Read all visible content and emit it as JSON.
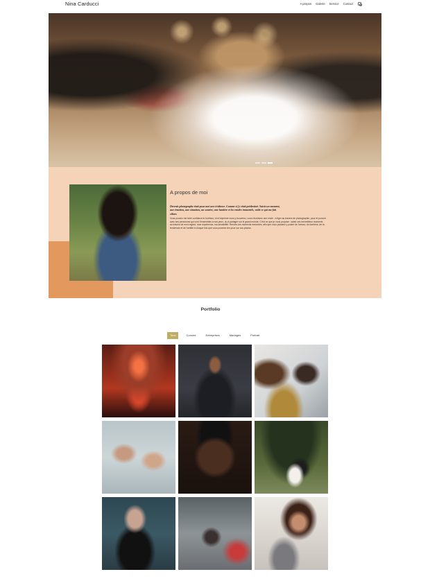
{
  "header": {
    "brand": "Nina Carducci",
    "nav": [
      "A propos",
      "Galerie",
      "Service",
      "Contact"
    ],
    "social_icon": "instagram-icon"
  },
  "hero": {
    "slides_count": 3,
    "active_slide": 3
  },
  "about": {
    "title": "A propos de moi",
    "lead": "Derenir photographe était pour moi une évidence. Comme si j'y était prédestiné. Saisir un moment, une émotion, une situation, un sourire, une lumière et les rendre immortels, voilà ce qui me fait vibrer.",
    "body": "Vous pouvez me faire confiance le bonheur, et m'exprimer vous y trouverez, vous réunissez une envie : à figer au travers de photographie, pour et pouvoir avec ses personnes qui vont l'ensembles à nos yeux, ou à partager sur le grand monde. C'est ce que je vous propose : saisir ces merveilleux moments au travers de mon regard, mon expérience, ma sensibilité. Rendre ces moments immortels, afin que vous puissiez y puiser de l'amour, du bonheur, de la tendresse et de l'amitié à chaque fois que vous poserez les yeux sur vos photos."
  },
  "portfolio": {
    "title": "Portfolio",
    "filters": [
      "Tous",
      "Concert",
      "Entreprises",
      "Mariages",
      "Portrait"
    ],
    "active_filter": "Tous"
  },
  "colors": {
    "about_bg": "#f5d3b8",
    "accent": "#e3985e",
    "filter_active": "#bead63"
  }
}
